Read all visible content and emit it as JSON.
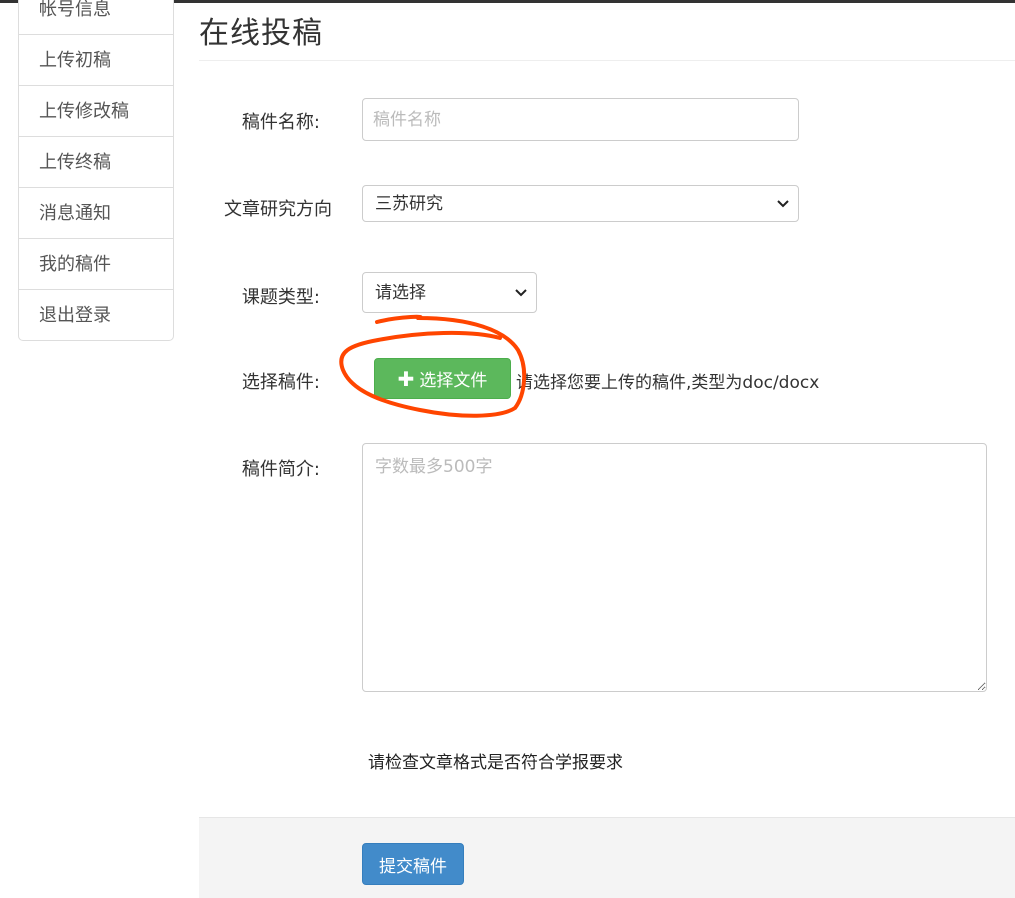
{
  "sidebar": {
    "items": [
      {
        "label": "帐号信息"
      },
      {
        "label": "上传初稿"
      },
      {
        "label": "上传修改稿"
      },
      {
        "label": "上传终稿"
      },
      {
        "label": "消息通知"
      },
      {
        "label": "我的稿件"
      },
      {
        "label": "退出登录"
      }
    ]
  },
  "main": {
    "title": "在线投稿",
    "form": {
      "name": {
        "label": "稿件名称:",
        "placeholder": "稿件名称",
        "value": ""
      },
      "direction": {
        "label": "文章研究方向",
        "value": "三苏研究"
      },
      "topic_type": {
        "label": "课题类型:",
        "value": "请选择"
      },
      "file": {
        "label": "选择稿件:",
        "button_label": "选择文件",
        "hint": "请选择您要上传的稿件,类型为doc/docx"
      },
      "summary": {
        "label": "稿件简介:",
        "placeholder": "字数最多500字",
        "value": ""
      }
    },
    "notice": "请检查文章格式是否符合学报要求",
    "submit_label": "提交稿件"
  },
  "icons": {
    "plus": "plus-icon",
    "chevron": "chevron-down-icon",
    "resize": "resize-handle-icon"
  },
  "colors": {
    "file_button": "#5cb85c",
    "submit_button": "#428bca",
    "annotation": "#ff4500"
  }
}
